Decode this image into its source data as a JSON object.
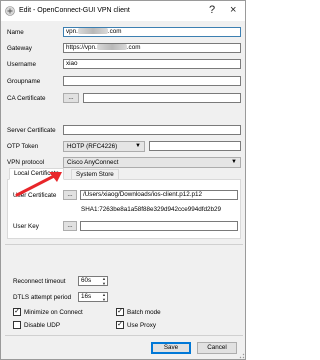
{
  "window": {
    "title": "Edit - OpenConnect-GUI VPN client",
    "icon": "openconnect-app-icon",
    "controls": {
      "help": "?",
      "close": "×"
    }
  },
  "form": {
    "name": {
      "label": "Name",
      "value_prefix": "vpn.",
      "value_suffix": ".com"
    },
    "gateway": {
      "label": "Gateway",
      "value_prefix": "https://vpn.",
      "value_suffix": ".com"
    },
    "username": {
      "label": "Username",
      "value": "xiao"
    },
    "groupname": {
      "label": "Groupname",
      "value": ""
    },
    "ca_certificate": {
      "label": "CA Certificate",
      "browse": "...",
      "value": ""
    },
    "server_certificate": {
      "label": "Server Certificate",
      "value": ""
    },
    "otp_token": {
      "label": "OTP Token",
      "type": "HOTP (RFC4226)",
      "value": ""
    },
    "vpn_protocol": {
      "label": "VPN protocol",
      "value": "Cisco AnyConnect"
    }
  },
  "tabs": [
    {
      "label": "Local Certificate",
      "active": true
    },
    {
      "label": "System Store",
      "active": false
    }
  ],
  "local_certificate": {
    "user_certificate": {
      "label": "User Certificate",
      "browse": "...",
      "value": "/Users/xiaog/Downloads/ios-client.p12.p12"
    },
    "sha1": "SHA1:7263be8a1a58f88e329d942cce994dfd2b29",
    "user_key": {
      "label": "User Key",
      "browse": "...",
      "value": ""
    }
  },
  "advanced": {
    "reconnect_timeout": {
      "label": "Reconnect timeout",
      "value": "60s"
    },
    "dtls_attempt_period": {
      "label": "DTLS attempt period",
      "value": "16s"
    },
    "minimize_on_connect": {
      "label": "Minimize on Connect",
      "checked": true
    },
    "batch_mode": {
      "label": "Batch mode",
      "checked": true
    },
    "disable_udp": {
      "label": "Disable UDP",
      "checked": false
    },
    "use_proxy": {
      "label": "Use Proxy",
      "checked": true
    }
  },
  "footer": {
    "save": "Save",
    "cancel": "Cancel"
  },
  "check_glyph": "✓",
  "colors": {
    "accent": "#0078d7",
    "arrow": "#e8262a"
  }
}
